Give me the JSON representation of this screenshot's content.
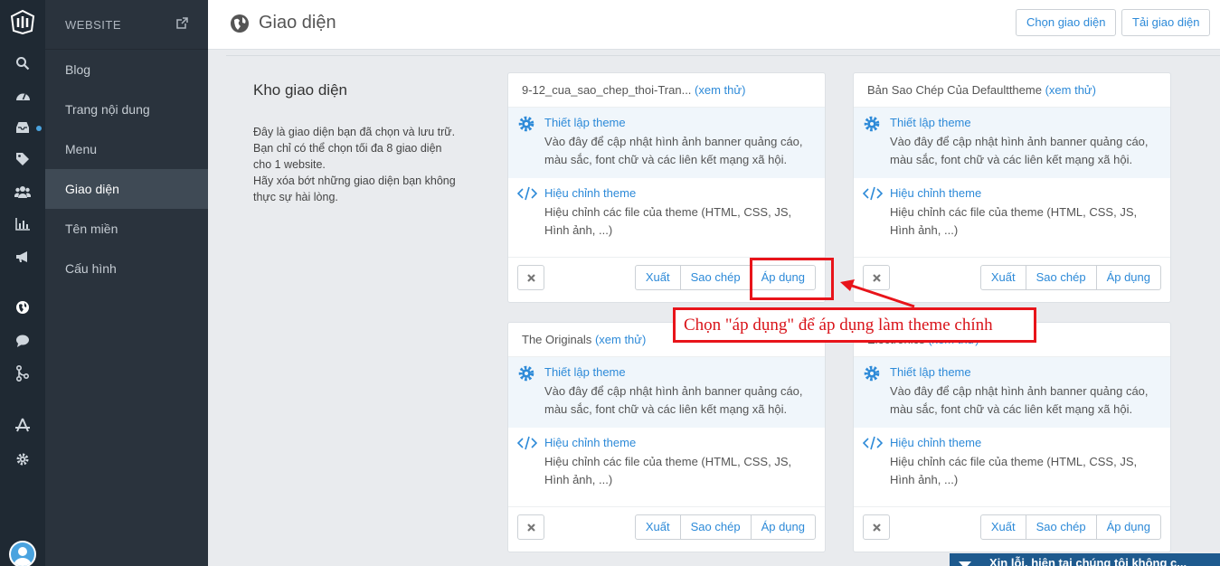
{
  "sidebar": {
    "header": "WEBSITE",
    "items": [
      {
        "label": "Blog"
      },
      {
        "label": "Trang nội dung"
      },
      {
        "label": "Menu"
      },
      {
        "label": "Giao diện",
        "active": true
      },
      {
        "label": "Tên miền"
      },
      {
        "label": "Cấu hình"
      }
    ]
  },
  "rail_icons": [
    "logo-icon",
    "search-icon",
    "dashboard-icon",
    "inbox-icon",
    "tags-icon",
    "users-icon",
    "chart-icon",
    "megaphone-icon",
    "globe-icon",
    "chat-icon",
    "branch-icon",
    "apps-icon",
    "gear-icon",
    "avatar-icon"
  ],
  "header": {
    "title": "Giao diện",
    "choose_label": "Chọn giao diện",
    "upload_label": "Tải giao diện"
  },
  "store": {
    "title": "Kho giao diện",
    "desc_lines": [
      "Đây là giao diện bạn đã chọn và lưu trữ.",
      "Bạn chỉ có thể chọn tối đa 8 giao diện",
      "cho 1 website.",
      "Hãy xóa bớt những giao diện bạn không",
      "thực sự hài lòng."
    ]
  },
  "cards": [
    {
      "name": "9-12_cua_sao_chep_thoi-Tran...",
      "preview": "(xem thử)"
    },
    {
      "name": "Bản Sao Chép Của Defaulttheme",
      "preview": "(xem thử)"
    },
    {
      "name": "The Originals",
      "preview": "(xem thử)"
    },
    {
      "name": "Electronics",
      "preview": "(xem thử)"
    }
  ],
  "card_common": {
    "setup_title": "Thiết lập theme",
    "setup_desc": "Vào đây để cập nhật hình ảnh banner quảng cáo, màu sắc, font chữ và các liên kết mạng xã hội.",
    "edit_title": "Hiệu chỉnh theme",
    "edit_desc": "Hiệu chỉnh các file của theme (HTML, CSS, JS, Hình ảnh, ...)",
    "export_label": "Xuất",
    "copy_label": "Sao chép",
    "apply_label": "Áp dụng"
  },
  "annotation": {
    "text": "Chọn \"áp dụng\" để áp dụng làm theme chính",
    "color": "#e8141a"
  },
  "chat": {
    "text": "Xin lỗi, hiện tại chúng tôi không c..."
  },
  "colors": {
    "accent": "#2d8ad8",
    "sidebar_bg": "#2a333d",
    "rail_bg": "#1f2933"
  }
}
